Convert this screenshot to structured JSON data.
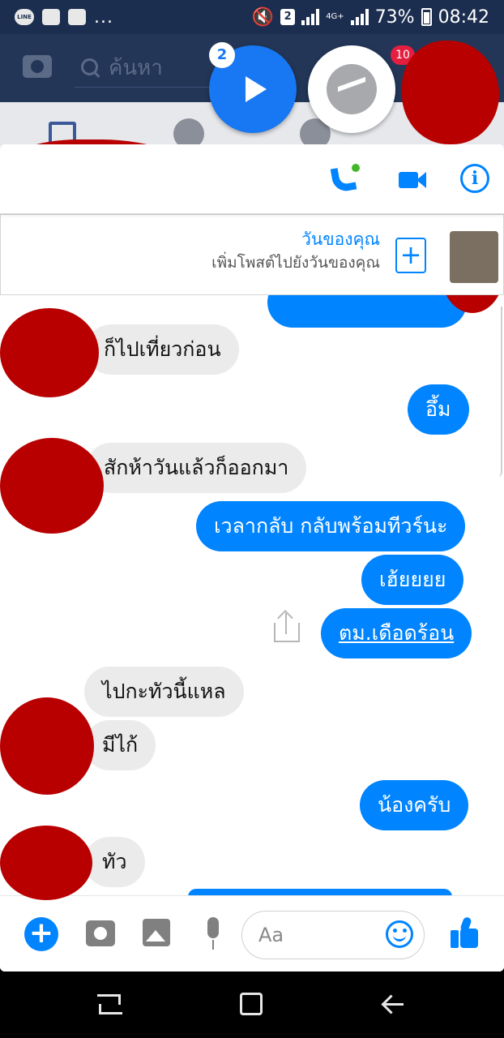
{
  "status_bar": {
    "line_icon": "LINE",
    "overflow": "...",
    "sim_number": "2",
    "network": "4G+",
    "battery": "73%",
    "time": "08:42"
  },
  "fb": {
    "search_placeholder": "ค้นหา",
    "notification_count": "10"
  },
  "chat_head": {
    "badge": "2"
  },
  "story": {
    "title": "วันของคุณ",
    "subtitle": "เพิ่มโพสต์ไปยังวันของคุณ",
    "add": "+"
  },
  "messages": [
    {
      "from": "them",
      "text": "ก็ไปเที่ยวก่อน"
    },
    {
      "from": "me",
      "text": "อึ้ม"
    },
    {
      "from": "them",
      "text": "สักห้าวันแล้วก็ออกมา"
    },
    {
      "from": "me",
      "text": "เวลากลับ กลับพร้อมทีวร์นะ"
    },
    {
      "from": "me",
      "text": "เฮ้ยยยย"
    },
    {
      "from": "me",
      "text": "ตม.เดือดร้อน"
    },
    {
      "from": "them",
      "text": "ไปกะทัวนี้แหล"
    },
    {
      "from": "them",
      "text": "มีไก้"
    },
    {
      "from": "me",
      "text": "น้องครับ"
    },
    {
      "from": "them",
      "text": "ทัว"
    }
  ],
  "composer": {
    "plus": "+",
    "placeholder": "Aa"
  },
  "header": {
    "info": "i"
  },
  "colors": {
    "messenger_blue": "#0084ff",
    "incoming_bubble": "#ebebeb",
    "fb_header": "#233658",
    "redaction": "#b80000"
  },
  "icons": [
    "camera-icon",
    "search-icon",
    "play-icon",
    "messenger-icon",
    "phone-icon",
    "video-icon",
    "info-icon",
    "add-icon",
    "share-icon",
    "image-icon",
    "mic-icon",
    "emoji-icon",
    "like-icon"
  ]
}
